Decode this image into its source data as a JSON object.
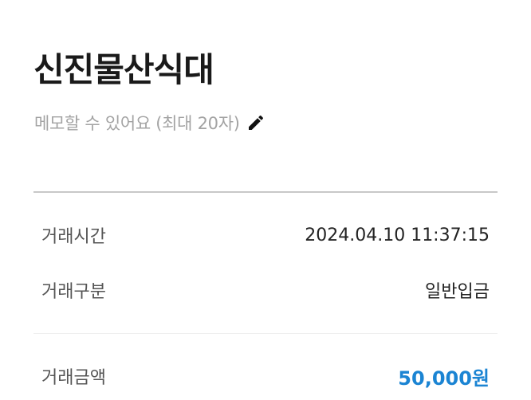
{
  "header": {
    "title": "신진물산식대"
  },
  "memo": {
    "placeholder": "메모할 수 있어요 (최대 20자)",
    "edit_icon": "pencil-icon"
  },
  "details": {
    "time_label": "거래시간",
    "time_value": "2024.04.10 11:37:15",
    "type_label": "거래구분",
    "type_value": "일반입금",
    "amount_label": "거래금액",
    "amount_value": "50,000원"
  },
  "colors": {
    "amount": "#1b84d3",
    "placeholder": "#a3a3a3"
  }
}
